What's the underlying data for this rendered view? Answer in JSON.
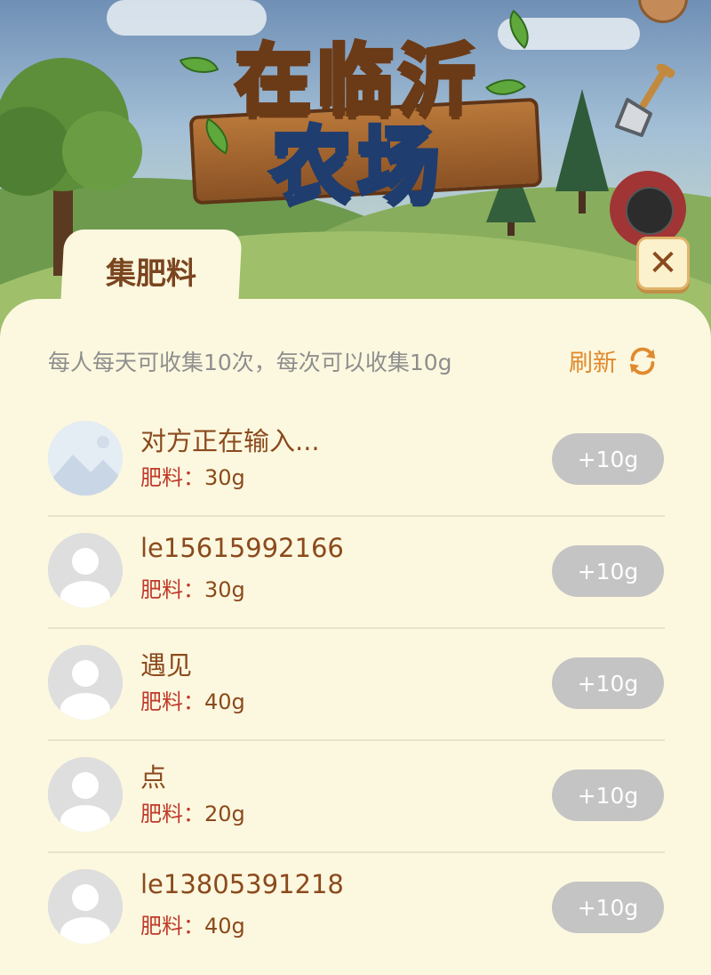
{
  "game_title": {
    "line1": "在临沂",
    "line2": "农场"
  },
  "close_symbol": "✕",
  "tab": {
    "label": "集肥料"
  },
  "notice": "每人每天可收集10次，每次可以收集10g",
  "refresh": {
    "label": "刷新",
    "icon": "refresh-icon"
  },
  "friends": [
    {
      "name": "对方正在输入...",
      "fert_label": "肥料：",
      "fert_value": "30g",
      "button": "+10g",
      "avatar": "image-unavailable-placeholder"
    },
    {
      "name": "le15615992166",
      "fert_label": "肥料：",
      "fert_value": "30g",
      "button": "+10g",
      "avatar": "default-user-avatar"
    },
    {
      "name": "遇见",
      "fert_label": "肥料：",
      "fert_value": "40g",
      "button": "+10g",
      "avatar": "default-user-avatar"
    },
    {
      "name": "点",
      "fert_label": "肥料：",
      "fert_value": "20g",
      "button": "+10g",
      "avatar": "default-user-avatar"
    },
    {
      "name": "le13805391218",
      "fert_label": "肥料：",
      "fert_value": "40g",
      "button": "+10g",
      "avatar": "default-user-avatar"
    }
  ],
  "colors": {
    "panel_bg": "#fcf8df",
    "accent_orange": "#e08a2e",
    "name_brown": "#8b4a1d",
    "fert_red": "#c0392b",
    "button_disabled": "#c4c4c4"
  }
}
